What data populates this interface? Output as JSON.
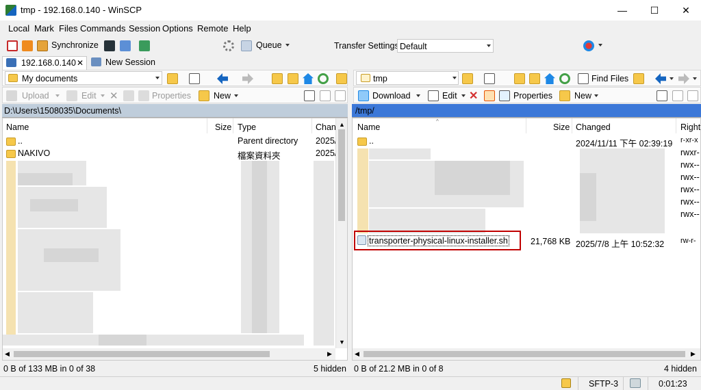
{
  "window": {
    "title": "tmp - 192.168.0.140 - WinSCP",
    "minimize": "—",
    "maximize": "☐",
    "close": "✕"
  },
  "menu": [
    "Local",
    "Mark",
    "Files",
    "Commands",
    "Session",
    "Options",
    "Remote",
    "Help"
  ],
  "toolbar": {
    "synchronize": "Synchronize",
    "queue": "Queue",
    "transfer_settings_label": "Transfer Settings",
    "transfer_settings_value": "Default"
  },
  "tabs": {
    "session": "192.168.0.140",
    "session_close": "✕",
    "new_session": "New Session"
  },
  "local": {
    "location": "My documents",
    "actions": {
      "upload": "Upload",
      "edit": "Edit",
      "properties": "Properties",
      "new": "New"
    },
    "path": "D:\\Users\\1508035\\Documents\\",
    "columns": [
      "Name",
      "Size",
      "Type",
      "Chan"
    ],
    "rows": [
      {
        "name": "..",
        "size": "",
        "type": "Parent directory",
        "changed": "2025/"
      },
      {
        "name": "NAKIVO",
        "size": "",
        "type": "檔案資料夾",
        "changed": "2025/"
      }
    ],
    "status": "0 B of 133 MB in 0 of 38",
    "hidden": "5 hidden"
  },
  "remote": {
    "location": "tmp",
    "actions": {
      "download": "Download",
      "edit": "Edit",
      "properties": "Properties",
      "new": "New"
    },
    "find_files": "Find Files",
    "path": "/tmp/",
    "columns": [
      "Name",
      "Size",
      "Changed",
      "Right"
    ],
    "rows": [
      {
        "name": "..",
        "size": "",
        "changed": "2024/11/11 下午 02:39:19",
        "rights": "r-xr-x"
      },
      {
        "name": "",
        "size": "",
        "changed": "",
        "rights": "rwxr-"
      },
      {
        "name": "",
        "size": "",
        "changed": "",
        "rights": "rwx--"
      },
      {
        "name": "",
        "size": "",
        "changed": "",
        "rights": "rwx--"
      },
      {
        "name": "",
        "size": "",
        "changed": "",
        "rights": "rwx--"
      },
      {
        "name": "",
        "size": "",
        "changed": "",
        "rights": "rwx--"
      },
      {
        "name": "",
        "size": "",
        "changed": "",
        "rights": "rwx--"
      },
      {
        "name": "transporter-physical-linux-installer.sh",
        "size": "21,768 KB",
        "changed": "2025/7/8 上午 10:52:32",
        "rights": "rw-r-"
      }
    ],
    "status": "0 B of 21.2 MB in 0 of 8",
    "hidden": "4 hidden"
  },
  "bottom": {
    "protocol": "SFTP-3",
    "time": "0:01:23"
  },
  "colors": {
    "highlight_border": "#c00000",
    "path_bar_active": "#3c78d8",
    "path_bar_inactive": "#bfcddb"
  }
}
